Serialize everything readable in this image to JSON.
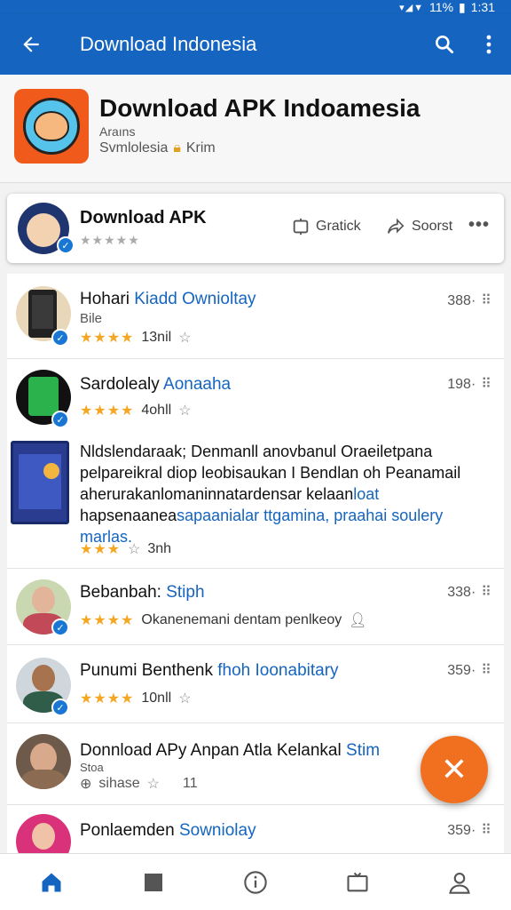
{
  "status": {
    "signal": "▾◢▼",
    "battery": "11%",
    "time": "1:31"
  },
  "appbar": {
    "title": "Download Indonesia",
    "back_icon": "arrow-back-icon",
    "search_icon": "search-icon",
    "menu_icon": "more-vert-icon"
  },
  "header": {
    "title": "Download APK Indoamesia",
    "subtitle": "Araıns",
    "meta_left": "Svmlolesia",
    "meta_right": "Krim"
  },
  "card": {
    "title": "Download APK",
    "stars": "★★★★★",
    "action1": "Gratick",
    "action2": "Soorst",
    "more": "•••"
  },
  "list": [
    {
      "name_a": "Hohari ",
      "name_b": "Kiadd Ownioltay",
      "sub": "Bile",
      "stars": "★★★★",
      "count": "13nil",
      "right": "388·",
      "right2": "⠿"
    },
    {
      "name_a": "Sardolealy ",
      "name_b": "Aonaaha",
      "stars": "★★★★",
      "count": "4ohll",
      "right": "198·",
      "right2": "⠿"
    },
    {
      "promo_l1": "Nldslendaraak; Denmanll anovbanul Oraeiletpana",
      "promo_l2": "pelpareikral diop leobisaukan I Bendlan oh Peanamail",
      "promo_l3a": "aherurakanlomaninnatardensar kelaan",
      "promo_l3b": "loat",
      "promo_l4a": "hapsenaanea",
      "promo_l4b": "sapaanialar ttgamina, praahai soulery",
      "promo_l5": "marlas.",
      "stars": "★★★",
      "count": "3nh"
    },
    {
      "name_a": "Bebanbah: ",
      "name_b": "Stiph",
      "stars": "★★★★",
      "desc": "Okanenemani dentam penlkeoy",
      "right": "338·",
      "right2": "⠿"
    },
    {
      "name_a": "Punumi Benthenk ",
      "name_b": "fhoh Ioonabitary",
      "stars": "★★★★",
      "count": "10nll",
      "right": "359·",
      "right2": "⠿"
    },
    {
      "name_a": "Donnload APy Anpan Atla Kelankal ",
      "name_b": "Stim",
      "sub": "Stoa",
      "count": "sihase",
      "count2": "11"
    },
    {
      "name_a": "Ponlaemden ",
      "name_b": "Sowniolay",
      "right": "359·",
      "right2": "⠿"
    }
  ],
  "fab": {
    "icon": "close-icon",
    "glyph": "✕"
  },
  "bottom_nav": [
    "home-icon",
    "stop-icon",
    "info-icon",
    "tv-icon",
    "person-icon"
  ],
  "colors": {
    "primary": "#1565c0",
    "accent": "#f07020",
    "star": "#f5a623"
  }
}
